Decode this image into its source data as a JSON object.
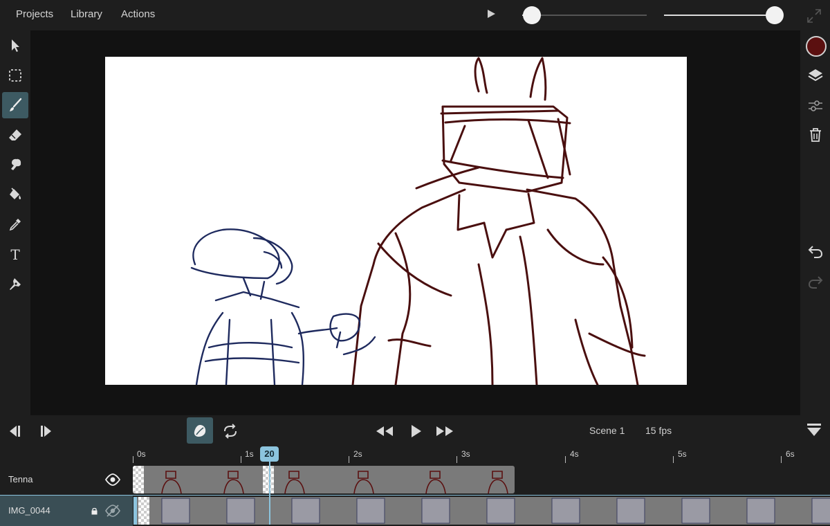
{
  "menu": {
    "projects": "Projects",
    "library": "Library",
    "actions": "Actions"
  },
  "sliders": {
    "playback_speed": 0.05,
    "brush_size": 0.94
  },
  "colors": {
    "accent": "#3d5a62",
    "playhead": "#8cc4de",
    "brush_color": "#5b1010",
    "stroke_blue": "#1e2a5e"
  },
  "tools": [
    "select-arrow-icon",
    "marquee-select-icon",
    "brush-icon",
    "eraser-icon",
    "smudge-icon",
    "fill-bucket-icon",
    "eyedropper-icon",
    "text-icon",
    "pen-icon"
  ],
  "active_tool": "brush-icon",
  "right_tools": [
    "color-swatch",
    "layers-icon",
    "adjust-sliders-icon",
    "trash-icon",
    "undo-icon",
    "redo-icon"
  ],
  "controls": {
    "scene_label": "Scene 1",
    "fps_label": "15 fps"
  },
  "timeline": {
    "ticks": [
      "0s",
      "1s",
      "2s",
      "3s",
      "4s",
      "5s",
      "6s"
    ],
    "current_frame": "20"
  },
  "layers": [
    {
      "name": "Tenna",
      "visible": true,
      "locked": false
    },
    {
      "name": "IMG_0044",
      "visible": false,
      "locked": true
    }
  ]
}
